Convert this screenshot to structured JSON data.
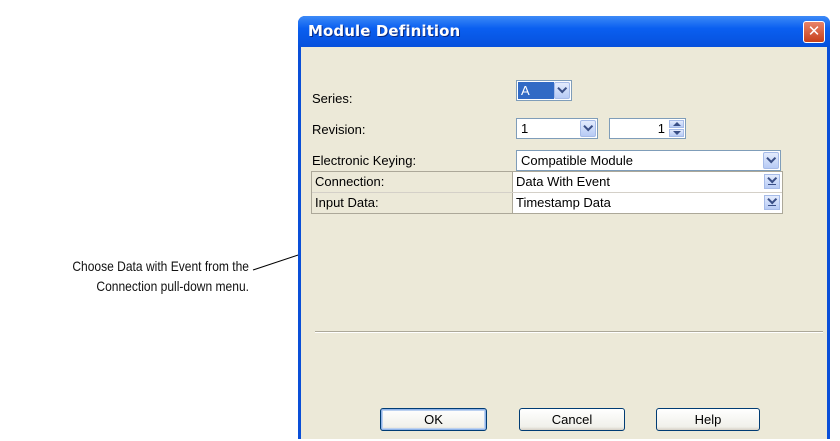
{
  "callout": {
    "line1": "Choose Data with Event from the",
    "line2": "Connection pull-down menu."
  },
  "dialog": {
    "title": "Module Definition",
    "close_icon": "close-icon",
    "fields": {
      "series_label": "Series:",
      "series_value": "A",
      "revision_label": "Revision:",
      "revision_major": "1",
      "revision_minor": "1",
      "keying_label": "Electronic Keying:",
      "keying_value": "Compatible Module"
    },
    "grid": {
      "rows": [
        {
          "name": "Connection:",
          "value": "Data With Event"
        },
        {
          "name": "Input Data:",
          "value": "Timestamp Data"
        }
      ]
    },
    "buttons": {
      "ok": "OK",
      "cancel": "Cancel",
      "help": "Help"
    }
  },
  "colors": {
    "titlebar": "#0a5ff0",
    "client": "#ece9d8",
    "selection": "#316ac5",
    "close": "#c7401b"
  }
}
